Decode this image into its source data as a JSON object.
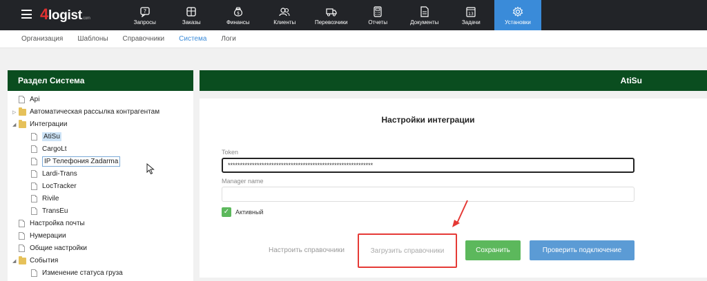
{
  "header": {
    "logo": {
      "text": "logist",
      "four": "4",
      "com": ".com"
    },
    "nav": [
      {
        "label": "Запросы",
        "icon": "chat-question-icon"
      },
      {
        "label": "Заказы",
        "icon": "box-icon"
      },
      {
        "label": "Финансы",
        "icon": "money-bag-icon"
      },
      {
        "label": "Клиенты",
        "icon": "users-icon"
      },
      {
        "label": "Перевозчики",
        "icon": "truck-icon"
      },
      {
        "label": "Отчеты",
        "icon": "calculator-icon"
      },
      {
        "label": "Документы",
        "icon": "document-icon"
      },
      {
        "label": "Задачи",
        "icon": "calendar-icon"
      },
      {
        "label": "Установки",
        "icon": "gear-icon",
        "active": true
      }
    ]
  },
  "subnav": [
    {
      "label": "Организация"
    },
    {
      "label": "Шаблоны"
    },
    {
      "label": "Справочники"
    },
    {
      "label": "Система",
      "active": true
    },
    {
      "label": "Логи"
    }
  ],
  "left": {
    "title": "Раздел Система",
    "tree": [
      {
        "label": "Api",
        "type": "doc",
        "level": 0
      },
      {
        "label": "Автоматическая рассылка контрагентам",
        "type": "folder",
        "level": 0,
        "arrow": "▷"
      },
      {
        "label": "Интеграции",
        "type": "folder",
        "level": 0,
        "arrow": "◢"
      },
      {
        "label": "AtiSu",
        "type": "doc",
        "level": 1,
        "state": "selected"
      },
      {
        "label": "CargoLt",
        "type": "doc",
        "level": 1
      },
      {
        "label": "IP Телефония Zadarma",
        "type": "doc",
        "level": 1,
        "state": "focused"
      },
      {
        "label": "Lardi-Trans",
        "type": "doc",
        "level": 1
      },
      {
        "label": "LocTracker",
        "type": "doc",
        "level": 1
      },
      {
        "label": "Rivile",
        "type": "doc",
        "level": 1
      },
      {
        "label": "TransEu",
        "type": "doc",
        "level": 1
      },
      {
        "label": "Настройка почты",
        "type": "doc",
        "level": 0
      },
      {
        "label": "Нумерации",
        "type": "doc",
        "level": 0
      },
      {
        "label": "Общие настройки",
        "type": "doc",
        "level": 0
      },
      {
        "label": "События",
        "type": "folder",
        "level": 0,
        "arrow": "◢"
      },
      {
        "label": "Изменение статуса груза",
        "type": "doc",
        "level": 1
      }
    ]
  },
  "right": {
    "title": "AtiSu",
    "card_title": "Настройки интеграции",
    "token_label": "Token",
    "token_value": "************************************************************",
    "manager_label": "Manager name",
    "manager_value": "",
    "active_label": "Активный",
    "active_checked": true,
    "buttons": {
      "configure": "Настроить справочники",
      "load": "Загрузить справочники",
      "save": "Сохранить",
      "check": "Проверить подключение"
    }
  },
  "colors": {
    "header_bg": "#222428",
    "accent": "#3a8bd9",
    "panel_green": "#0a4d1f",
    "save_green": "#5cb85c",
    "highlight_red": "#e53935"
  }
}
